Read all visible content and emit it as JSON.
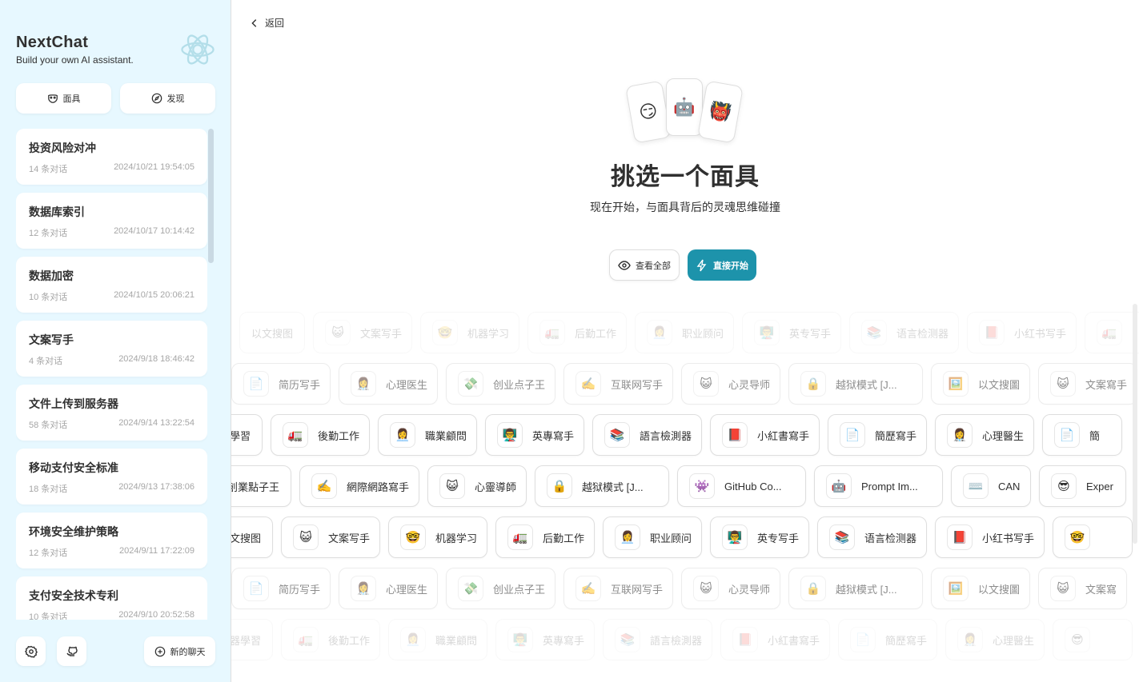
{
  "sidebar": {
    "title": "NextChat",
    "subtitle": "Build your own AI assistant.",
    "tools": [
      {
        "label": "面具",
        "icon": "mask-icon"
      },
      {
        "label": "发现",
        "icon": "compass-icon"
      }
    ],
    "chats": [
      {
        "title": "投资风险对冲",
        "count": "14 条对话",
        "time": "2024/10/21 19:54:05"
      },
      {
        "title": "数据库索引",
        "count": "12 条对话",
        "time": "2024/10/17 10:14:42"
      },
      {
        "title": "数据加密",
        "count": "10 条对话",
        "time": "2024/10/15 20:06:21"
      },
      {
        "title": "文案写手",
        "count": "4 条对话",
        "time": "2024/9/18 18:46:42"
      },
      {
        "title": "文件上传到服务器",
        "count": "58 条对话",
        "time": "2024/9/14 13:22:54"
      },
      {
        "title": "移动支付安全标准",
        "count": "18 条对话",
        "time": "2024/9/13 17:38:06"
      },
      {
        "title": "环境安全维护策略",
        "count": "12 条对话",
        "time": "2024/9/11 17:22:09"
      },
      {
        "title": "支付安全技术专利",
        "count": "10 条对话",
        "time": "2024/9/10 20:52:58"
      }
    ],
    "new_chat_label": "新的聊天"
  },
  "main": {
    "back_label": "返回",
    "cards": [
      "😏",
      "🤖",
      "👹"
    ],
    "title": "挑选一个面具",
    "subtitle": "现在开始，与面具背后的灵魂思维碰撞",
    "view_all_label": "查看全部",
    "start_label": "直接开始",
    "rows": [
      {
        "offset": 10,
        "fade": 1,
        "items": [
          {
            "e": "",
            "t": "以文搜图"
          },
          {
            "e": "😺",
            "t": "文案写手"
          },
          {
            "e": "🤓",
            "t": "机器学习"
          },
          {
            "e": "🚛",
            "t": "后勤工作"
          },
          {
            "e": "👩‍💼",
            "t": "职业顾问"
          },
          {
            "e": "👨‍🏫",
            "t": "英专写手"
          },
          {
            "e": "📚",
            "t": "语言检测器"
          },
          {
            "e": "📕",
            "t": "小红书写手"
          },
          {
            "e": "🚛",
            "t": ""
          }
        ]
      },
      {
        "offset": 0,
        "fade": 2,
        "items": [
          {
            "e": "📄",
            "t": "简历写手"
          },
          {
            "e": "👩‍⚕️",
            "t": "心理医生"
          },
          {
            "e": "💸",
            "t": "创业点子王"
          },
          {
            "e": "✍️",
            "t": "互联网写手"
          },
          {
            "e": "😺",
            "t": "心灵导师"
          },
          {
            "e": "🔒",
            "t": "越狱模式 [J..."
          },
          {
            "e": "🖼️",
            "t": "以文搜圖"
          },
          {
            "e": "😺",
            "t": "文案寫手"
          }
        ]
      },
      {
        "offset": -30,
        "fade": 3,
        "items": [
          {
            "e": "",
            "t": "器學習"
          },
          {
            "e": "🚛",
            "t": "後勤工作"
          },
          {
            "e": "👩‍💼",
            "t": "職業顧問"
          },
          {
            "e": "👨‍🏫",
            "t": "英專寫手"
          },
          {
            "e": "📚",
            "t": "語言檢測器"
          },
          {
            "e": "📕",
            "t": "小紅書寫手"
          },
          {
            "e": "📄",
            "t": "簡歷寫手"
          },
          {
            "e": "👩‍⚕️",
            "t": "心理醫生"
          },
          {
            "e": "📄",
            "t": "簡"
          }
        ]
      },
      {
        "offset": -20,
        "fade": 3,
        "items": [
          {
            "e": "",
            "t": "創業點子王"
          },
          {
            "e": "✍️",
            "t": "網際網路寫手"
          },
          {
            "e": "😺",
            "t": "心靈導師"
          },
          {
            "e": "🔒",
            "t": "越狱模式 [J..."
          },
          {
            "e": "👾",
            "t": "GitHub Co..."
          },
          {
            "e": "🤖",
            "t": "Prompt Im..."
          },
          {
            "e": "⌨️",
            "t": "CAN"
          },
          {
            "e": "😎",
            "t": "Exper"
          }
        ]
      },
      {
        "offset": -30,
        "fade": 3,
        "items": [
          {
            "e": "",
            "t": "以文搜图"
          },
          {
            "e": "😺",
            "t": "文案写手"
          },
          {
            "e": "🤓",
            "t": "机器学习"
          },
          {
            "e": "🚛",
            "t": "后勤工作"
          },
          {
            "e": "👩‍💼",
            "t": "职业顾问"
          },
          {
            "e": "👨‍🏫",
            "t": "英专写手"
          },
          {
            "e": "📚",
            "t": "语言检测器"
          },
          {
            "e": "📕",
            "t": "小红书写手"
          },
          {
            "e": "🤓",
            "t": ""
          }
        ]
      },
      {
        "offset": 0,
        "fade": 2,
        "items": [
          {
            "e": "📄",
            "t": "简历写手"
          },
          {
            "e": "👩‍⚕️",
            "t": "心理医生"
          },
          {
            "e": "💸",
            "t": "创业点子王"
          },
          {
            "e": "✍️",
            "t": "互联网写手"
          },
          {
            "e": "😺",
            "t": "心灵导师"
          },
          {
            "e": "🔒",
            "t": "越狱模式 [J..."
          },
          {
            "e": "🖼️",
            "t": "以文搜圖"
          },
          {
            "e": "😺",
            "t": "文案寫"
          }
        ]
      },
      {
        "offset": -30,
        "fade": 1,
        "items": [
          {
            "e": "",
            "t": "機器學習"
          },
          {
            "e": "🚛",
            "t": "後勤工作"
          },
          {
            "e": "👩‍💼",
            "t": "職業顧問"
          },
          {
            "e": "👨‍🏫",
            "t": "英專寫手"
          },
          {
            "e": "📚",
            "t": "語言檢測器"
          },
          {
            "e": "📕",
            "t": "小紅書寫手"
          },
          {
            "e": "📄",
            "t": "簡歷寫手"
          },
          {
            "e": "👩‍⚕️",
            "t": "心理醫生"
          },
          {
            "e": "😎",
            "t": ""
          }
        ]
      }
    ]
  }
}
